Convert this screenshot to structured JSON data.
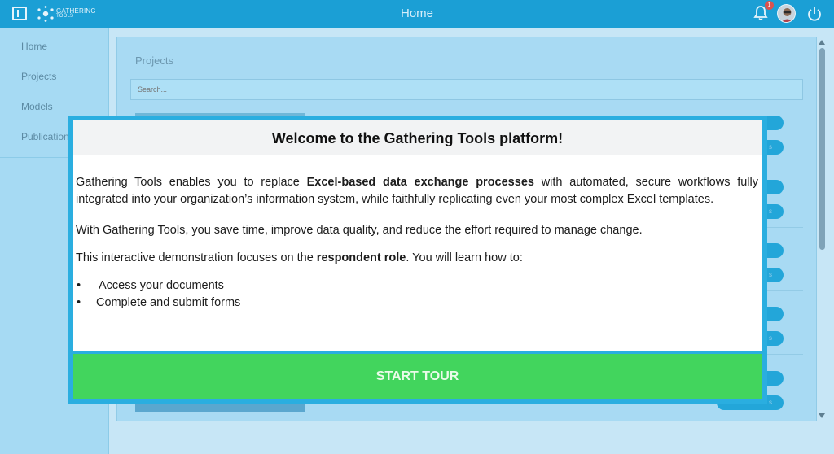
{
  "app": {
    "logo_line1": "GATHERING",
    "logo_line2": "TOOLS",
    "page_title": "Home",
    "notification_count": "1"
  },
  "sidebar": {
    "items": [
      {
        "label": "Home"
      },
      {
        "label": "Projects"
      },
      {
        "label": "Models"
      },
      {
        "label": "Publications"
      }
    ]
  },
  "main": {
    "section_title": "Projects",
    "search_placeholder": "Search..."
  },
  "background_pills": {
    "text": "s"
  },
  "modal": {
    "title": "Welcome to the Gathering Tools platform!",
    "p1_before": "Gathering Tools enables you to replace ",
    "p1_bold": "Excel-based data exchange processes",
    "p1_after": " with automated, secure workflows fully integrated into your organization’s information system, while faithfully replicating even your most complex Excel templates.",
    "p2": "With Gathering Tools, you save time, improve data quality, and reduce the effort required to manage change.",
    "p3_before": "This interactive demonstration focuses on the ",
    "p3_bold": "respondent role",
    "p3_after": ". You will learn how to:",
    "bullets": [
      "Access your documents",
      "Complete and submit forms"
    ],
    "start_button": "START TOUR"
  },
  "colors": {
    "topbar": "#1b9fd5",
    "modal_border": "#2aaee0",
    "start_button": "#42d55d"
  }
}
